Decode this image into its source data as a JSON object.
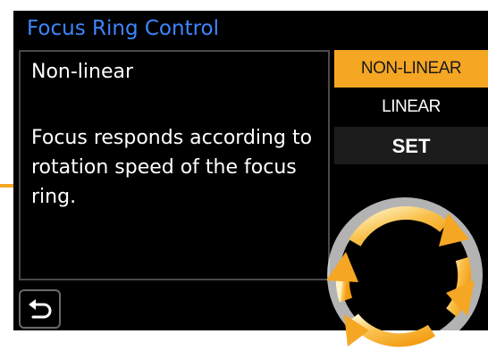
{
  "header": {
    "title": "Focus Ring Control"
  },
  "description": {
    "heading": "Non-linear",
    "body": "Focus responds according to rotation speed of the focus ring."
  },
  "options": [
    {
      "label": "NON-LINEAR",
      "selected": true
    },
    {
      "label": "LINEAR",
      "selected": false
    },
    {
      "label": "SET",
      "selected": false
    }
  ],
  "footer": {
    "back_icon": "return-arrow-icon"
  },
  "graphic": {
    "icon": "rotation-arrows-icon"
  },
  "colors": {
    "accent": "#f5a623",
    "title": "#3d86ff",
    "background": "#000000",
    "text": "#ffffff"
  }
}
